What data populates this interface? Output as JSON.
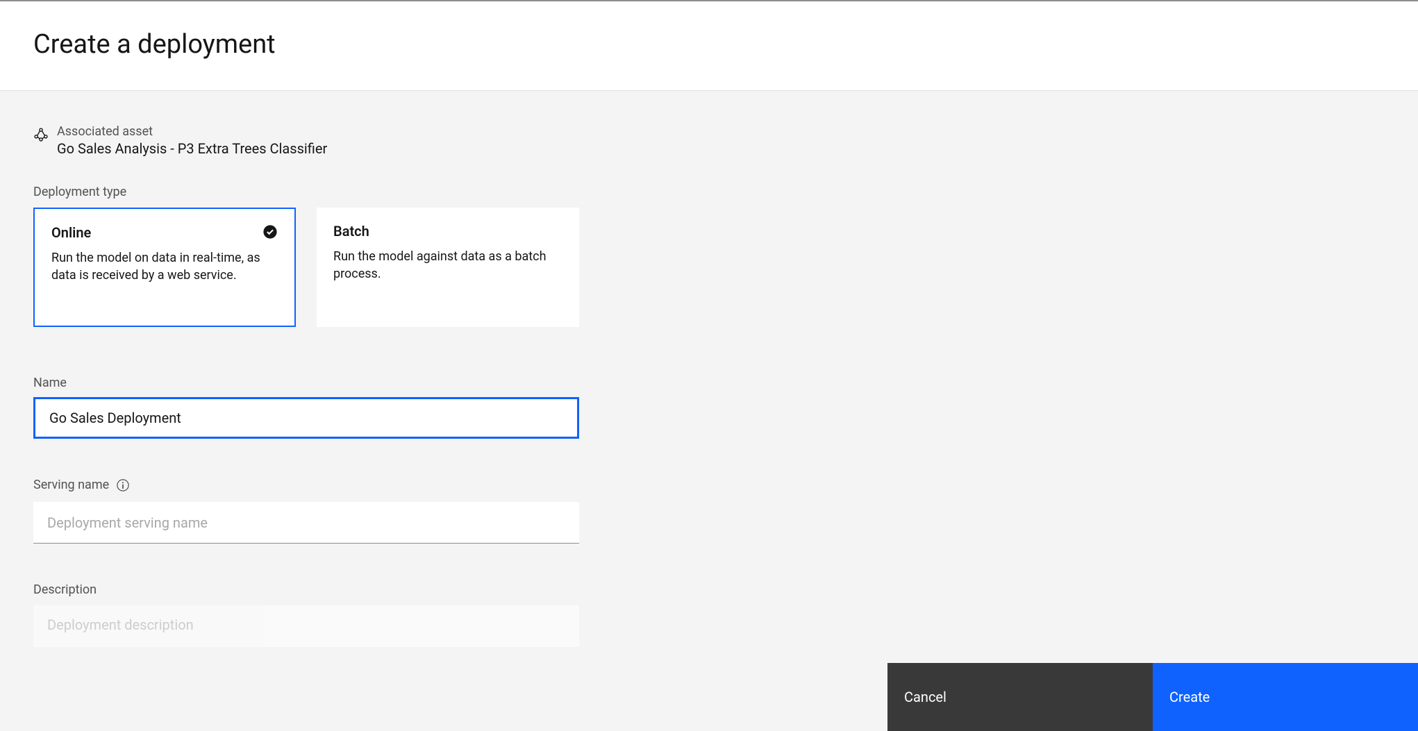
{
  "header": {
    "title": "Create a deployment"
  },
  "asset": {
    "label": "Associated asset",
    "name": "Go Sales Analysis - P3 Extra Trees Classifier"
  },
  "deploymentType": {
    "label": "Deployment type",
    "options": [
      {
        "title": "Online",
        "description": "Run the model on data in real-time, as data is received by a web service.",
        "selected": true
      },
      {
        "title": "Batch",
        "description": "Run the model against data as a batch process.",
        "selected": false
      }
    ]
  },
  "nameField": {
    "label": "Name",
    "value": "Go Sales Deployment"
  },
  "servingField": {
    "label": "Serving name",
    "placeholder": "Deployment serving name",
    "value": ""
  },
  "descriptionField": {
    "label": "Description",
    "placeholder": "Deployment description",
    "value": ""
  },
  "footer": {
    "cancel": "Cancel",
    "create": "Create"
  }
}
